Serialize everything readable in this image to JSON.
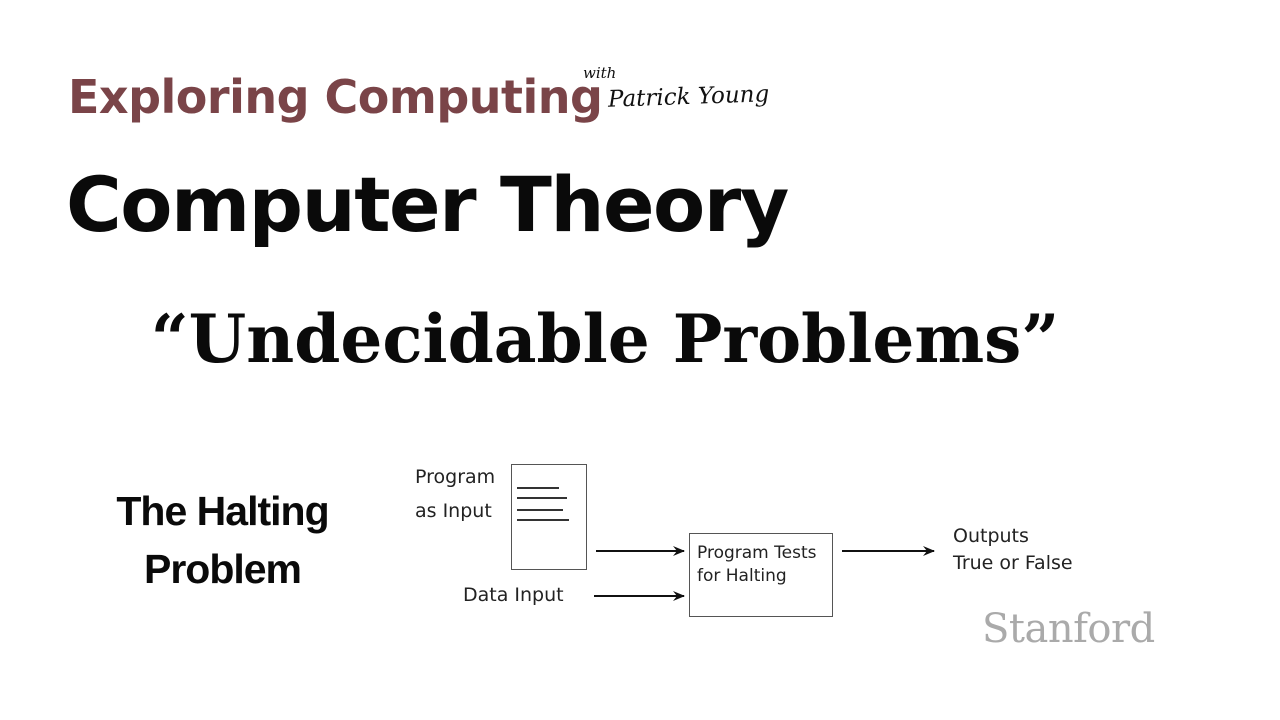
{
  "header": {
    "series_title": "Exploring Computing",
    "with_label": "with",
    "author": "Patrick Young",
    "course_title": "Computer Theory",
    "lecture_title": "“Undecidable Problems”"
  },
  "topic": {
    "line1": "The Halting",
    "line2": "Problem"
  },
  "diagram": {
    "program_input_line1": "Program",
    "program_input_line2": "as Input",
    "data_input": "Data Input",
    "tester_line1": "Program Tests",
    "tester_line2": "for Halting",
    "output_line1": "Outputs",
    "output_line2": "True or False"
  },
  "logo": {
    "text": "Stanford"
  },
  "colors": {
    "series_title": "#7a4448",
    "text": "#0a0a0a",
    "logo": "#aaaaaa"
  }
}
